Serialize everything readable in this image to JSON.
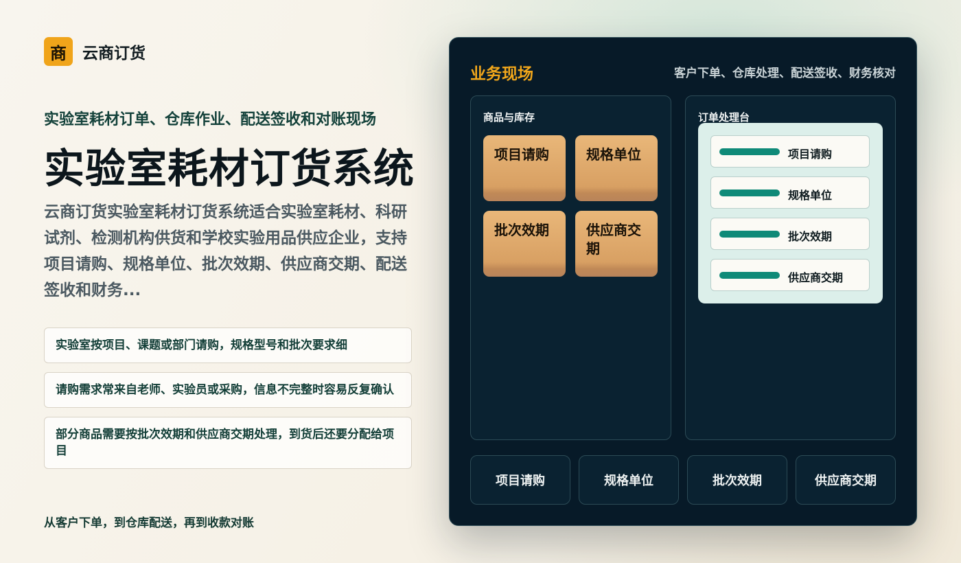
{
  "brand": {
    "logo_char": "商",
    "name": "云商订货"
  },
  "hero": {
    "eyebrow": "实验室耗材订单、仓库作业、配送签收和对账现场",
    "title": "实验室耗材订货系统",
    "description": "云商订货实验室耗材订货系统适合实验室耗材、科研试剂、检测机构供货和学校实验用品供应企业，支持项目请购、规格单位、批次效期、供应商交期、配送签收和财务..."
  },
  "pain_points": [
    "实验室按项目、课题或部门请购，规格型号和批次要求细",
    "请购需求常来自老师、实验员或采购，信息不完整时容易反复确认",
    "部分商品需要按批次效期和供应商交期处理，到货后还要分配给项目"
  ],
  "footer_note": "从客户下单，到仓库配送，再到收款对账",
  "panel": {
    "title": "业务现场",
    "subtitle": "客户下单、仓库处理、配送签收、财务核对",
    "inventory": {
      "title": "商品与库存",
      "tiles": [
        "项目请购",
        "规格单位",
        "批次效期",
        "供应商交期"
      ]
    },
    "orders": {
      "title": "订单处理台",
      "rows": [
        "项目请购",
        "规格单位",
        "批次效期",
        "供应商交期"
      ]
    },
    "stages": [
      "项目请购",
      "规格单位",
      "批次效期",
      "供应商交期"
    ]
  },
  "colors": {
    "accent": "#f0a41a",
    "panel_bg": "#071a28",
    "bar": "#0f8a78",
    "heading_green": "#13413a"
  }
}
